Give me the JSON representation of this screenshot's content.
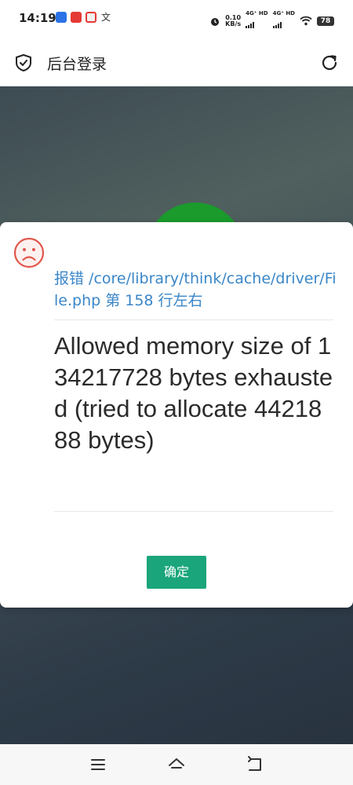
{
  "status_bar": {
    "time": "14:19",
    "speed_value": "0.10",
    "speed_unit": "KB/s",
    "signal1": "4G⁺ HD",
    "signal2": "4G⁺ HD",
    "battery": "78",
    "notif_char": "文"
  },
  "header": {
    "title": "后台登录",
    "icon": "shield-check-icon",
    "refresh_icon": "refresh-icon"
  },
  "dialog": {
    "icon": "sad-face-icon",
    "error_location": "报错 /core/library/think/cache/driver/File.php 第 158 行左右",
    "error_message": "Allowed memory size of 134217728 bytes exhausted (tried to allocate 4421888 bytes)",
    "ok_label": "确定"
  },
  "colors": {
    "link_blue": "#3a86c8",
    "button_green": "#1aa57a",
    "error_red": "#e0574b"
  },
  "nav": {
    "items": [
      "menu-icon",
      "home-icon",
      "back-icon"
    ]
  }
}
